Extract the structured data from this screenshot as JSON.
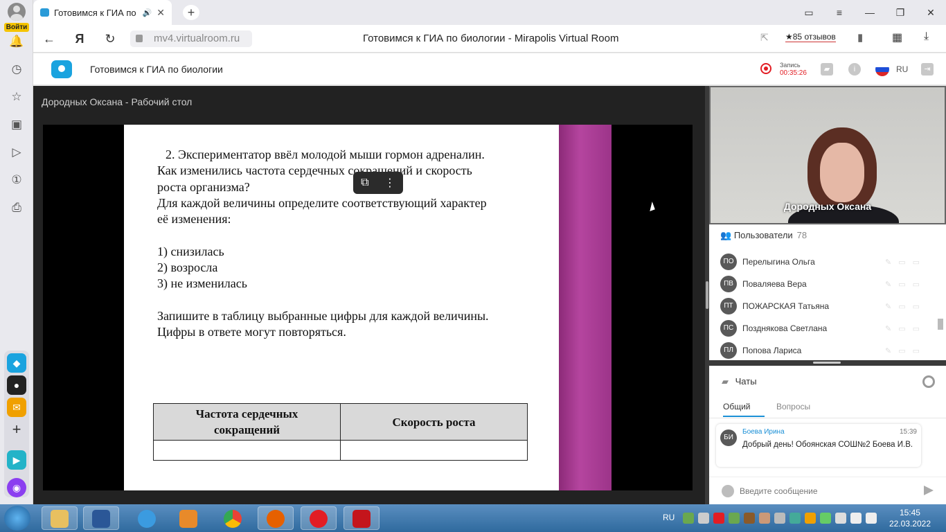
{
  "browser": {
    "login_label": "Войти",
    "tab_title": "Готовимся к ГИА по",
    "url": "mv4.virtualroom.ru",
    "page_title": "Готовимся к ГИА по биологии - Mirapolis Virtual Room",
    "reviews": "★85 отзывов"
  },
  "header": {
    "room_title": "Готовимся к ГИА по биологии",
    "rec_label": "Запись",
    "rec_time": "00:35:26",
    "lang": "RU"
  },
  "stage": {
    "title": "Дородных Оксана - Рабочий стол",
    "slide_lines": [
      "2. Экспериментатор ввёл молодой мыши гормон адреналин.",
      "Как изменились частота сердечных сокращений и скорость",
      "роста организма?",
      "Для каждой величины определите соответствующий характер",
      "её изменения:",
      "",
      "1) снизилась",
      "2) возросла",
      "3) не изменилась",
      "",
      "Запишите в таблицу выбранные цифры для каждой величины.",
      "Цифры в ответе могут повторяться."
    ],
    "table_headers": [
      "Частота сердечных сокращений",
      "Скорость роста"
    ]
  },
  "video": {
    "name": "Дородных Оксана"
  },
  "users": {
    "title": "Пользователи",
    "count": "78",
    "list": [
      {
        "initials": "ПО",
        "name": "Перелыгина Ольга"
      },
      {
        "initials": "ПВ",
        "name": "Поваляева Вера"
      },
      {
        "initials": "ПТ",
        "name": "ПОЖАРСКАЯ Татьяна"
      },
      {
        "initials": "ПС",
        "name": "Позднякова Светлана"
      },
      {
        "initials": "ПЛ",
        "name": "Попова Лариса"
      }
    ]
  },
  "chats": {
    "title": "Чаты",
    "tabs": [
      "Общий",
      "Вопросы"
    ],
    "message": {
      "initials": "БИ",
      "author": "Боева Ирина",
      "time": "15:39",
      "text": "Добрый день! Обоянская СОШ№2 Боева И.В."
    },
    "input_placeholder": "Введите сообщение"
  },
  "taskbar": {
    "lang": "RU",
    "time": "15:45",
    "date": "22.03.2022"
  },
  "colors": {
    "accent": "#1a8fd6",
    "record": "#e21d24",
    "slide_purple": "#b5459f"
  }
}
